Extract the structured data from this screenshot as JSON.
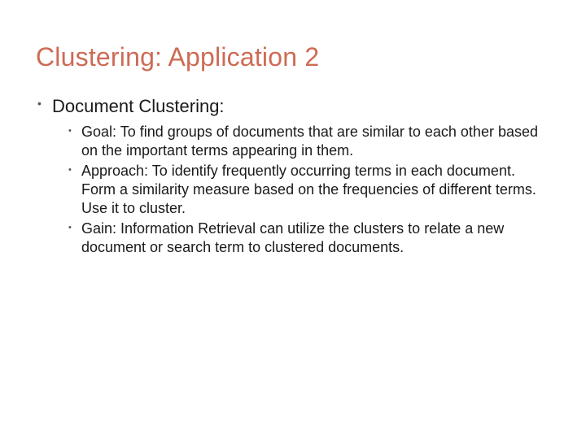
{
  "title": "Clustering: Application 2",
  "bullets": {
    "l1_0": "Document Clustering:",
    "l2_0": "Goal: To find groups of documents that are similar to each other based on the important terms appearing in them.",
    "l2_1": "Approach: To identify frequently occurring terms in each document. Form a similarity measure based on the frequencies of different terms. Use it to cluster.",
    "l2_2": "Gain: Information Retrieval can utilize the clusters to relate a new document or search term to clustered documents."
  }
}
